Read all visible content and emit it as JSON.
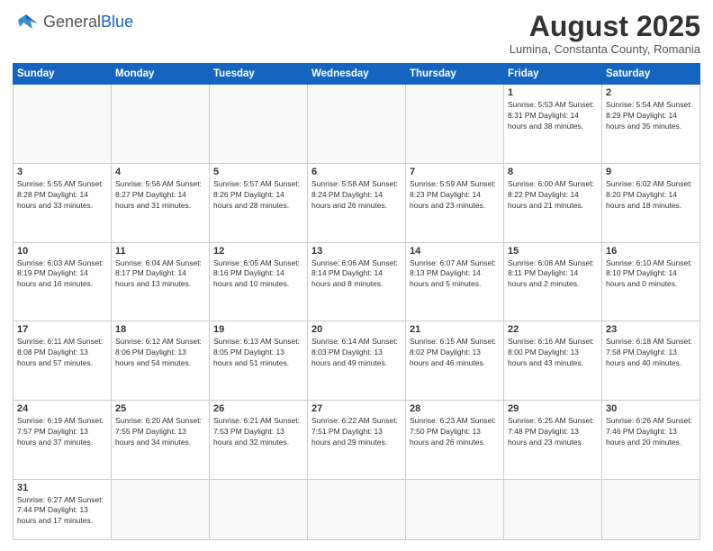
{
  "header": {
    "logo_general": "General",
    "logo_blue": "Blue",
    "month_year": "August 2025",
    "location": "Lumina, Constanta County, Romania"
  },
  "days_of_week": [
    "Sunday",
    "Monday",
    "Tuesday",
    "Wednesday",
    "Thursday",
    "Friday",
    "Saturday"
  ],
  "weeks": [
    [
      {
        "day": "",
        "info": ""
      },
      {
        "day": "",
        "info": ""
      },
      {
        "day": "",
        "info": ""
      },
      {
        "day": "",
        "info": ""
      },
      {
        "day": "",
        "info": ""
      },
      {
        "day": "1",
        "info": "Sunrise: 5:53 AM\nSunset: 8:31 PM\nDaylight: 14 hours and 38 minutes."
      },
      {
        "day": "2",
        "info": "Sunrise: 5:54 AM\nSunset: 8:29 PM\nDaylight: 14 hours and 35 minutes."
      }
    ],
    [
      {
        "day": "3",
        "info": "Sunrise: 5:55 AM\nSunset: 8:28 PM\nDaylight: 14 hours and 33 minutes."
      },
      {
        "day": "4",
        "info": "Sunrise: 5:56 AM\nSunset: 8:27 PM\nDaylight: 14 hours and 31 minutes."
      },
      {
        "day": "5",
        "info": "Sunrise: 5:57 AM\nSunset: 8:26 PM\nDaylight: 14 hours and 28 minutes."
      },
      {
        "day": "6",
        "info": "Sunrise: 5:58 AM\nSunset: 8:24 PM\nDaylight: 14 hours and 26 minutes."
      },
      {
        "day": "7",
        "info": "Sunrise: 5:59 AM\nSunset: 8:23 PM\nDaylight: 14 hours and 23 minutes."
      },
      {
        "day": "8",
        "info": "Sunrise: 6:00 AM\nSunset: 8:22 PM\nDaylight: 14 hours and 21 minutes."
      },
      {
        "day": "9",
        "info": "Sunrise: 6:02 AM\nSunset: 8:20 PM\nDaylight: 14 hours and 18 minutes."
      }
    ],
    [
      {
        "day": "10",
        "info": "Sunrise: 6:03 AM\nSunset: 8:19 PM\nDaylight: 14 hours and 16 minutes."
      },
      {
        "day": "11",
        "info": "Sunrise: 6:04 AM\nSunset: 8:17 PM\nDaylight: 14 hours and 13 minutes."
      },
      {
        "day": "12",
        "info": "Sunrise: 6:05 AM\nSunset: 8:16 PM\nDaylight: 14 hours and 10 minutes."
      },
      {
        "day": "13",
        "info": "Sunrise: 6:06 AM\nSunset: 8:14 PM\nDaylight: 14 hours and 8 minutes."
      },
      {
        "day": "14",
        "info": "Sunrise: 6:07 AM\nSunset: 8:13 PM\nDaylight: 14 hours and 5 minutes."
      },
      {
        "day": "15",
        "info": "Sunrise: 6:08 AM\nSunset: 8:11 PM\nDaylight: 14 hours and 2 minutes."
      },
      {
        "day": "16",
        "info": "Sunrise: 6:10 AM\nSunset: 8:10 PM\nDaylight: 14 hours and 0 minutes."
      }
    ],
    [
      {
        "day": "17",
        "info": "Sunrise: 6:11 AM\nSunset: 8:08 PM\nDaylight: 13 hours and 57 minutes."
      },
      {
        "day": "18",
        "info": "Sunrise: 6:12 AM\nSunset: 8:06 PM\nDaylight: 13 hours and 54 minutes."
      },
      {
        "day": "19",
        "info": "Sunrise: 6:13 AM\nSunset: 8:05 PM\nDaylight: 13 hours and 51 minutes."
      },
      {
        "day": "20",
        "info": "Sunrise: 6:14 AM\nSunset: 8:03 PM\nDaylight: 13 hours and 49 minutes."
      },
      {
        "day": "21",
        "info": "Sunrise: 6:15 AM\nSunset: 8:02 PM\nDaylight: 13 hours and 46 minutes."
      },
      {
        "day": "22",
        "info": "Sunrise: 6:16 AM\nSunset: 8:00 PM\nDaylight: 13 hours and 43 minutes."
      },
      {
        "day": "23",
        "info": "Sunrise: 6:18 AM\nSunset: 7:58 PM\nDaylight: 13 hours and 40 minutes."
      }
    ],
    [
      {
        "day": "24",
        "info": "Sunrise: 6:19 AM\nSunset: 7:57 PM\nDaylight: 13 hours and 37 minutes."
      },
      {
        "day": "25",
        "info": "Sunrise: 6:20 AM\nSunset: 7:55 PM\nDaylight: 13 hours and 34 minutes."
      },
      {
        "day": "26",
        "info": "Sunrise: 6:21 AM\nSunset: 7:53 PM\nDaylight: 13 hours and 32 minutes."
      },
      {
        "day": "27",
        "info": "Sunrise: 6:22 AM\nSunset: 7:51 PM\nDaylight: 13 hours and 29 minutes."
      },
      {
        "day": "28",
        "info": "Sunrise: 6:23 AM\nSunset: 7:50 PM\nDaylight: 13 hours and 26 minutes."
      },
      {
        "day": "29",
        "info": "Sunrise: 6:25 AM\nSunset: 7:48 PM\nDaylight: 13 hours and 23 minutes."
      },
      {
        "day": "30",
        "info": "Sunrise: 6:26 AM\nSunset: 7:46 PM\nDaylight: 13 hours and 20 minutes."
      }
    ],
    [
      {
        "day": "31",
        "info": "Sunrise: 6:27 AM\nSunset: 7:44 PM\nDaylight: 13 hours and 17 minutes."
      },
      {
        "day": "",
        "info": ""
      },
      {
        "day": "",
        "info": ""
      },
      {
        "day": "",
        "info": ""
      },
      {
        "day": "",
        "info": ""
      },
      {
        "day": "",
        "info": ""
      },
      {
        "day": "",
        "info": ""
      }
    ]
  ]
}
